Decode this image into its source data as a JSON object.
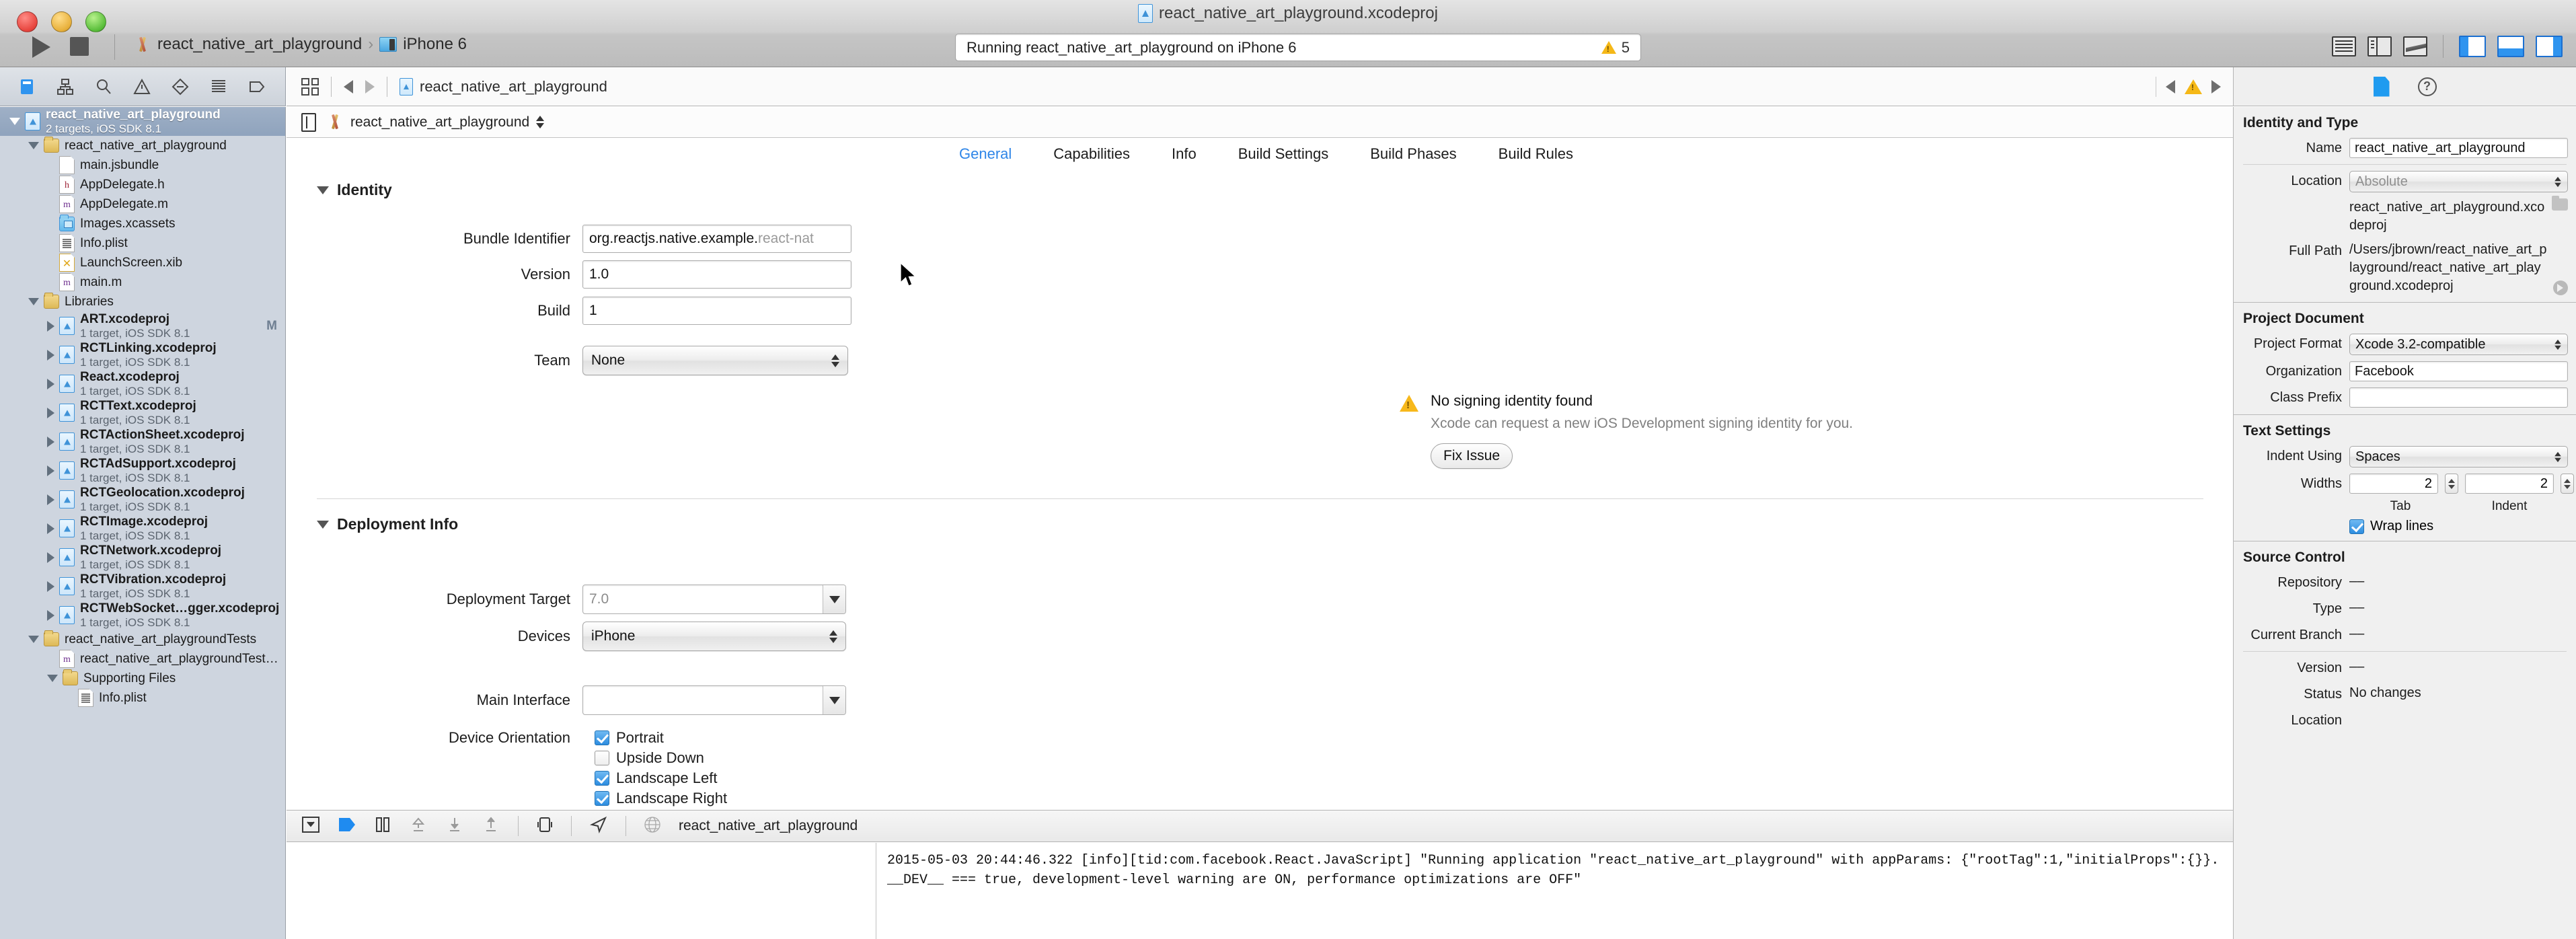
{
  "window": {
    "title": "react_native_art_playground.xcodeproj",
    "traffic_lights": [
      "close",
      "minimize",
      "zoom"
    ]
  },
  "toolbar": {
    "run_label": "Run",
    "stop_label": "Stop",
    "scheme": "react_native_art_playground",
    "destination": "iPhone 6",
    "status_text": "Running react_native_art_playground on iPhone 6",
    "warning_count": "5",
    "editor_modes": [
      "standard-editor",
      "assistant-editor",
      "version-editor"
    ],
    "view_toggles": [
      "navigator-pane",
      "debug-pane",
      "utilities-pane"
    ]
  },
  "navigator": {
    "tabs": [
      "project-navigator",
      "symbol-navigator",
      "find-navigator",
      "issue-navigator",
      "test-navigator",
      "debug-navigator",
      "breakpoint-navigator",
      "report-navigator"
    ],
    "items": [
      {
        "name": "react_native_art_playground",
        "sub": "2 targets, iOS SDK 8.1",
        "icon": "xcodeproj",
        "indent": 0,
        "twisty": "down",
        "bold": true,
        "selected": true,
        "badge": ""
      },
      {
        "name": "react_native_art_playground",
        "sub": "",
        "icon": "folder",
        "indent": 1,
        "twisty": "down",
        "bold": false,
        "selected": false,
        "badge": ""
      },
      {
        "name": "main.jsbundle",
        "sub": "",
        "icon": "file",
        "indent": 2,
        "twisty": "none",
        "bold": false,
        "selected": false,
        "badge": ""
      },
      {
        "name": "AppDelegate.h",
        "sub": "",
        "icon": "file-h",
        "indent": 2,
        "twisty": "none",
        "bold": false,
        "selected": false,
        "badge": ""
      },
      {
        "name": "AppDelegate.m",
        "sub": "",
        "icon": "file-m",
        "indent": 2,
        "twisty": "none",
        "bold": false,
        "selected": false,
        "badge": ""
      },
      {
        "name": "Images.xcassets",
        "sub": "",
        "icon": "xcassets",
        "indent": 2,
        "twisty": "none",
        "bold": false,
        "selected": false,
        "badge": ""
      },
      {
        "name": "Info.plist",
        "sub": "",
        "icon": "plist",
        "indent": 2,
        "twisty": "none",
        "bold": false,
        "selected": false,
        "badge": ""
      },
      {
        "name": "LaunchScreen.xib",
        "sub": "",
        "icon": "xib",
        "indent": 2,
        "twisty": "none",
        "bold": false,
        "selected": false,
        "badge": ""
      },
      {
        "name": "main.m",
        "sub": "",
        "icon": "file-m",
        "indent": 2,
        "twisty": "none",
        "bold": false,
        "selected": false,
        "badge": ""
      },
      {
        "name": "Libraries",
        "sub": "",
        "icon": "folder",
        "indent": 1,
        "twisty": "down",
        "bold": false,
        "selected": false,
        "badge": ""
      },
      {
        "name": "ART.xcodeproj",
        "sub": "1 target, iOS SDK 8.1",
        "icon": "xcodeproj",
        "indent": 2,
        "twisty": "right",
        "bold": true,
        "selected": false,
        "badge": "M"
      },
      {
        "name": "RCTLinking.xcodeproj",
        "sub": "1 target, iOS SDK 8.1",
        "icon": "xcodeproj",
        "indent": 2,
        "twisty": "right",
        "bold": true,
        "selected": false,
        "badge": ""
      },
      {
        "name": "React.xcodeproj",
        "sub": "1 target, iOS SDK 8.1",
        "icon": "xcodeproj",
        "indent": 2,
        "twisty": "right",
        "bold": true,
        "selected": false,
        "badge": ""
      },
      {
        "name": "RCTText.xcodeproj",
        "sub": "1 target, iOS SDK 8.1",
        "icon": "xcodeproj",
        "indent": 2,
        "twisty": "right",
        "bold": true,
        "selected": false,
        "badge": ""
      },
      {
        "name": "RCTActionSheet.xcodeproj",
        "sub": "1 target, iOS SDK 8.1",
        "icon": "xcodeproj",
        "indent": 2,
        "twisty": "right",
        "bold": true,
        "selected": false,
        "badge": ""
      },
      {
        "name": "RCTAdSupport.xcodeproj",
        "sub": "1 target, iOS SDK 8.1",
        "icon": "xcodeproj",
        "indent": 2,
        "twisty": "right",
        "bold": true,
        "selected": false,
        "badge": ""
      },
      {
        "name": "RCTGeolocation.xcodeproj",
        "sub": "1 target, iOS SDK 8.1",
        "icon": "xcodeproj",
        "indent": 2,
        "twisty": "right",
        "bold": true,
        "selected": false,
        "badge": ""
      },
      {
        "name": "RCTImage.xcodeproj",
        "sub": "1 target, iOS SDK 8.1",
        "icon": "xcodeproj",
        "indent": 2,
        "twisty": "right",
        "bold": true,
        "selected": false,
        "badge": ""
      },
      {
        "name": "RCTNetwork.xcodeproj",
        "sub": "1 target, iOS SDK 8.1",
        "icon": "xcodeproj",
        "indent": 2,
        "twisty": "right",
        "bold": true,
        "selected": false,
        "badge": ""
      },
      {
        "name": "RCTVibration.xcodeproj",
        "sub": "1 target, iOS SDK 8.1",
        "icon": "xcodeproj",
        "indent": 2,
        "twisty": "right",
        "bold": true,
        "selected": false,
        "badge": ""
      },
      {
        "name": "RCTWebSocket…gger.xcodeproj",
        "sub": "1 target, iOS SDK 8.1",
        "icon": "xcodeproj",
        "indent": 2,
        "twisty": "right",
        "bold": true,
        "selected": false,
        "badge": ""
      },
      {
        "name": "react_native_art_playgroundTests",
        "sub": "",
        "icon": "folder",
        "indent": 1,
        "twisty": "down",
        "bold": false,
        "selected": false,
        "badge": ""
      },
      {
        "name": "react_native_art_playgroundTests.m",
        "sub": "",
        "icon": "file-m",
        "indent": 2,
        "twisty": "none",
        "bold": false,
        "selected": false,
        "badge": ""
      },
      {
        "name": "Supporting Files",
        "sub": "",
        "icon": "folder",
        "indent": 2,
        "twisty": "down",
        "bold": false,
        "selected": false,
        "badge": ""
      },
      {
        "name": "Info.plist",
        "sub": "",
        "icon": "plist",
        "indent": 3,
        "twisty": "none",
        "bold": false,
        "selected": false,
        "badge": ""
      }
    ]
  },
  "breadcrumb": {
    "project": "react_native_art_playground"
  },
  "editor": {
    "target_name": "react_native_art_playground",
    "tabs": [
      {
        "label": "General",
        "active": true
      },
      {
        "label": "Capabilities",
        "active": false
      },
      {
        "label": "Info",
        "active": false
      },
      {
        "label": "Build Settings",
        "active": false
      },
      {
        "label": "Build Phases",
        "active": false
      },
      {
        "label": "Build Rules",
        "active": false
      }
    ],
    "identity": {
      "section_title": "Identity",
      "bundle_identifier_label": "Bundle Identifier",
      "bundle_identifier_value": "org.reactjs.native.example.",
      "bundle_identifier_value_dim": "react-nat",
      "version_label": "Version",
      "version_value": "1.0",
      "build_label": "Build",
      "build_value": "1",
      "team_label": "Team",
      "team_value": "None",
      "warning_title": "No signing identity found",
      "warning_body": "Xcode can request a new iOS Development signing identity for you.",
      "fix_issue_label": "Fix Issue"
    },
    "deployment": {
      "section_title": "Deployment Info",
      "deployment_target_label": "Deployment Target",
      "deployment_target_value": "7.0",
      "devices_label": "Devices",
      "devices_value": "iPhone",
      "main_interface_label": "Main Interface",
      "main_interface_value": "",
      "device_orientation_label": "Device Orientation",
      "orientations": [
        {
          "label": "Portrait",
          "checked": true
        },
        {
          "label": "Upside Down",
          "checked": false
        },
        {
          "label": "Landscape Left",
          "checked": true
        },
        {
          "label": "Landscape Right",
          "checked": true
        }
      ]
    }
  },
  "debug_area": {
    "toolbar_icons": [
      "hide-debug-area-icon",
      "continue-icon",
      "pause-icon",
      "step-over-icon",
      "step-into-icon",
      "step-out-icon",
      "simulate-location-icon",
      "location-icon",
      "thread-icon"
    ],
    "process_label": "react_native_art_playground",
    "console_text": "2015-05-03 20:44:46.322 [info][tid:com.facebook.React.JavaScript] \"Running application \"react_native_art_playground\" with appParams: {\"rootTag\":1,\"initialProps\":{}}. __DEV__ === true, development-level warning are ON, performance optimizations are OFF\""
  },
  "inspector": {
    "tabs": [
      "file-inspector",
      "quick-help-inspector"
    ],
    "identity_and_type": {
      "title": "Identity and Type",
      "name_label": "Name",
      "name_value": "react_native_art_playground",
      "location_label": "Location",
      "location_value": "Absolute",
      "location_file": "react_native_art_playground.xcodeproj",
      "full_path_label": "Full Path",
      "full_path_value": "/Users/jbrown/react_native_art_playground/react_native_art_playground.xcodeproj"
    },
    "project_document": {
      "title": "Project Document",
      "project_format_label": "Project Format",
      "project_format_value": "Xcode 3.2-compatible",
      "organization_label": "Organization",
      "organization_value": "Facebook",
      "class_prefix_label": "Class Prefix",
      "class_prefix_value": ""
    },
    "text_settings": {
      "title": "Text Settings",
      "indent_using_label": "Indent Using",
      "indent_using_value": "Spaces",
      "widths_label": "Widths",
      "tab_value": "2",
      "indent_value": "2",
      "tab_sublabel": "Tab",
      "indent_sublabel": "Indent",
      "wrap_lines_label": "Wrap lines",
      "wrap_lines_checked": true
    },
    "source_control": {
      "title": "Source Control",
      "repository_label": "Repository",
      "repository_value": "––",
      "type_label": "Type",
      "type_value": "––",
      "current_branch_label": "Current Branch",
      "current_branch_value": "––",
      "version_label": "Version",
      "version_value": "––",
      "status_label": "Status",
      "status_value": "No changes",
      "location_label": "Location",
      "location_value": ""
    }
  },
  "colors": {
    "accent": "#2f86e8",
    "warning": "#f5b817",
    "selection": "#8fa3bd"
  }
}
